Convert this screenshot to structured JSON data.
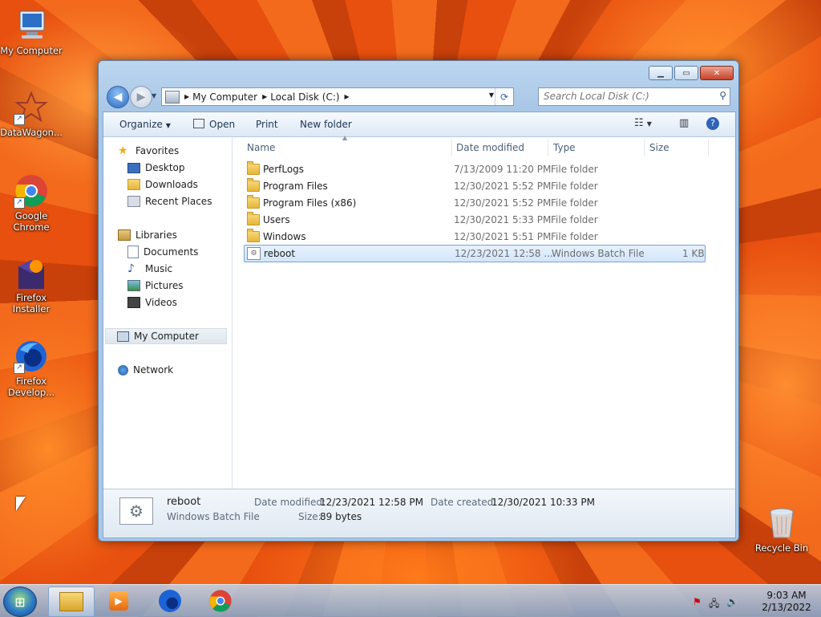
{
  "desktop": {
    "icons": [
      {
        "label": "My Computer"
      },
      {
        "label": "DataWagon..."
      },
      {
        "label": "Google Chrome"
      },
      {
        "label": "Firefox Installer"
      },
      {
        "label": "Firefox Develop..."
      },
      {
        "label": "Recycle Bin"
      }
    ]
  },
  "window": {
    "address": {
      "crumbs": [
        "My Computer",
        "Local Disk (C:)"
      ]
    },
    "search": {
      "placeholder": "Search Local Disk (C:)"
    },
    "toolbar": {
      "organize": "Organize",
      "open": "Open",
      "print": "Print",
      "new_folder": "New folder"
    },
    "nav": {
      "favorites": "Favorites",
      "desktop": "Desktop",
      "downloads": "Downloads",
      "recent": "Recent Places",
      "libraries": "Libraries",
      "documents": "Documents",
      "music": "Music",
      "pictures": "Pictures",
      "videos": "Videos",
      "computer": "My Computer",
      "network": "Network"
    },
    "columns": {
      "name": "Name",
      "date": "Date modified",
      "type": "Type",
      "size": "Size"
    },
    "files": [
      {
        "name": "PerfLogs",
        "date": "7/13/2009 11:20 PM",
        "type": "File folder",
        "size": ""
      },
      {
        "name": "Program Files",
        "date": "12/30/2021 5:52 PM",
        "type": "File folder",
        "size": ""
      },
      {
        "name": "Program Files (x86)",
        "date": "12/30/2021 5:52 PM",
        "type": "File folder",
        "size": ""
      },
      {
        "name": "Users",
        "date": "12/30/2021 5:33 PM",
        "type": "File folder",
        "size": ""
      },
      {
        "name": "Windows",
        "date": "12/30/2021 5:51 PM",
        "type": "File folder",
        "size": ""
      },
      {
        "name": "reboot",
        "date": "12/23/2021 12:58 ...",
        "type": "Windows Batch File",
        "size": "1 KB"
      }
    ],
    "details": {
      "name": "reboot",
      "type": "Windows Batch File",
      "date_modified_label": "Date modified:",
      "date_modified": "12/23/2021 12:58 PM",
      "date_created_label": "Date created:",
      "date_created": "12/30/2021 10:33 PM",
      "size_label": "Size:",
      "size": "89 bytes"
    }
  },
  "taskbar": {
    "time": "9:03 AM",
    "date": "2/13/2022"
  },
  "icons": {
    "back": "arrow-left-icon",
    "forward": "arrow-right-icon",
    "search": "magnifier-icon",
    "help": "question-icon"
  }
}
